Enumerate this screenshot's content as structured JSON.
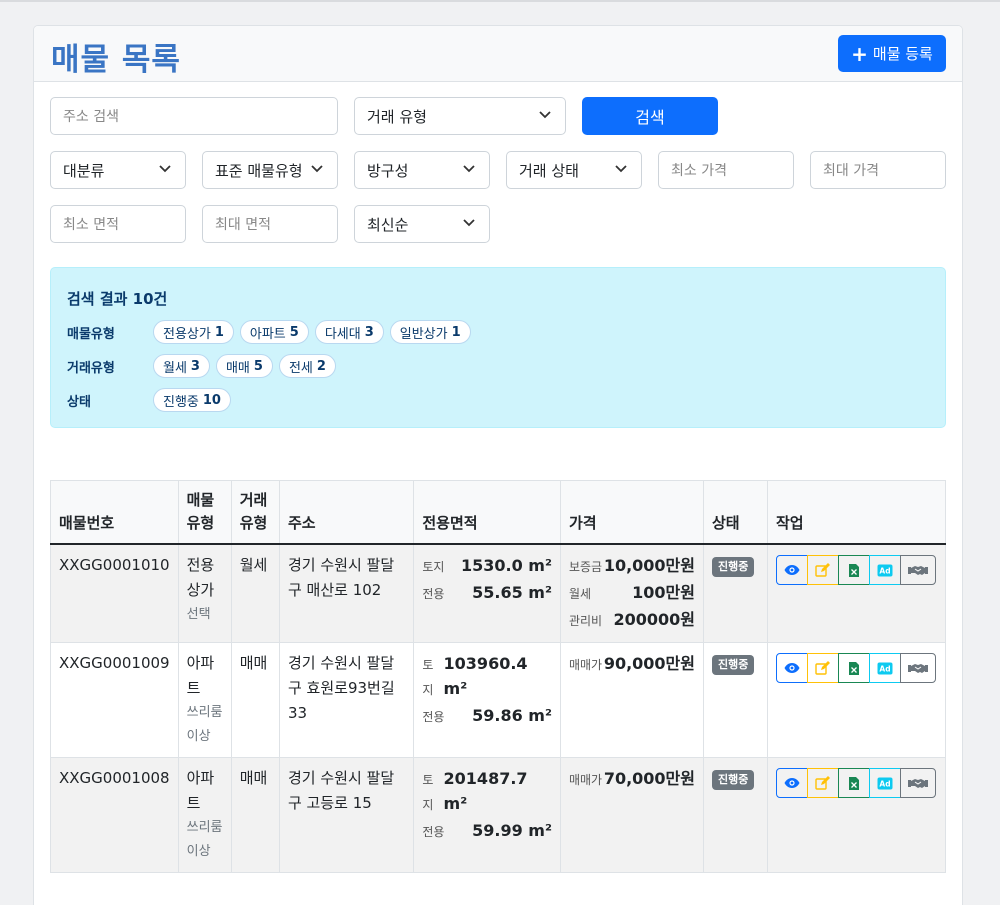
{
  "header": {
    "title": "매물 목록",
    "register_label": "매물 등록"
  },
  "search": {
    "address_placeholder": "주소 검색",
    "deal_type_select": "거래 유형",
    "search_label": "검색",
    "category_select": "대분류",
    "property_type_select": "표준 매물유형",
    "room_select": "방구성",
    "status_select": "거래 상태",
    "min_price_placeholder": "최소 가격",
    "max_price_placeholder": "최대 가격",
    "min_area_placeholder": "최소 면적",
    "max_area_placeholder": "최대 면적",
    "sort_select": "최신순"
  },
  "summary": {
    "title": "검색 결과 10건",
    "rows": [
      {
        "label": "매물유형",
        "pills": [
          {
            "name": "전용상가",
            "count": "1"
          },
          {
            "name": "아파트",
            "count": "5"
          },
          {
            "name": "다세대",
            "count": "3"
          },
          {
            "name": "일반상가",
            "count": "1"
          }
        ]
      },
      {
        "label": "거래유형",
        "pills": [
          {
            "name": "월세",
            "count": "3"
          },
          {
            "name": "매매",
            "count": "5"
          },
          {
            "name": "전세",
            "count": "2"
          }
        ]
      },
      {
        "label": "상태",
        "pills": [
          {
            "name": "진행중",
            "count": "10"
          }
        ]
      }
    ]
  },
  "table": {
    "headers": {
      "id": "매물번호",
      "type": "매물유형",
      "deal": "거래유형",
      "address": "주소",
      "area": "전용면적",
      "price": "가격",
      "status": "상태",
      "actions": "작업"
    },
    "rows": [
      {
        "id": "XXGG0001010",
        "type": "전용상가",
        "subtype": "선택",
        "deal": "월세",
        "address": "경기 수원시 팔달구 매산로 102",
        "land_label": "토지",
        "land": "1530.0 m²",
        "excl_label": "전용",
        "excl": "55.65 m²",
        "prices": [
          {
            "k": "보증금",
            "v": "10,000만원"
          },
          {
            "k": "월세",
            "v": "100만원"
          },
          {
            "k": "관리비",
            "v": "200000원"
          }
        ],
        "status": "진행중"
      },
      {
        "id": "XXGG0001009",
        "type": "아파트",
        "subtype": "쓰리룸 이상",
        "deal": "매매",
        "address": "경기 수원시 팔달구 효원로93번길 33",
        "land_label": "토지",
        "land": "103960.4 m²",
        "excl_label": "전용",
        "excl": "59.86 m²",
        "prices": [
          {
            "k": "매매가",
            "v": "90,000만원"
          }
        ],
        "status": "진행중"
      },
      {
        "id": "XXGG0001008",
        "type": "아파트",
        "subtype": "쓰리룸 이상",
        "deal": "매매",
        "address": "경기 수원시 팔달구 고등로 15",
        "land_label": "토지",
        "land": "201487.7 m²",
        "excl_label": "전용",
        "excl": "59.99 m²",
        "prices": [
          {
            "k": "매매가",
            "v": "70,000만원"
          }
        ],
        "status": "진행중"
      }
    ]
  },
  "icons": {
    "view": "eye-icon",
    "edit": "pencil-square-icon",
    "doc": "file-excel-icon",
    "ad": "ad-icon",
    "deal": "handshake-icon"
  },
  "colors": {
    "primary": "#0d6efd",
    "title": "#3a75c4",
    "info_bg": "#cff4fc",
    "badge": "#6c757d"
  }
}
